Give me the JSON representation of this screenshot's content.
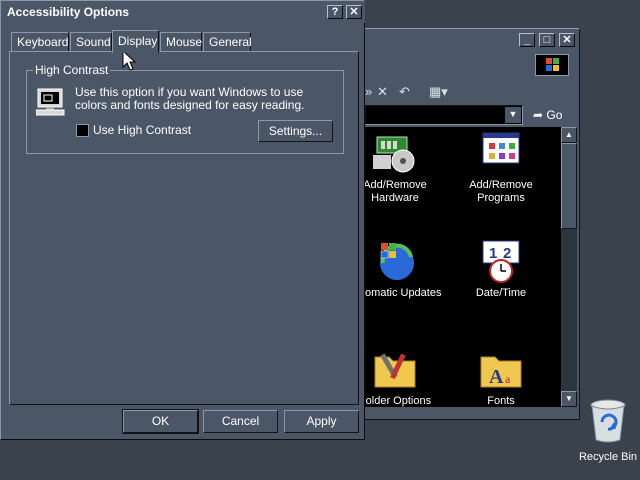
{
  "control_panel": {
    "go_label": "Go",
    "items": [
      {
        "label": "Add/Remove\nHardware",
        "icon": "hardware-icon"
      },
      {
        "label": "Add/Remove\nPrograms",
        "icon": "programs-icon"
      },
      {
        "label": "Automatic Updates",
        "icon": "windows-update-icon"
      },
      {
        "label": "Date/Time",
        "icon": "calendar-clock-icon"
      },
      {
        "label": "Folder Options",
        "icon": "folder-tools-icon"
      },
      {
        "label": "Fonts",
        "icon": "fonts-folder-icon"
      }
    ]
  },
  "dialog": {
    "title": "Accessibility Options",
    "help_label": "?",
    "close_label": "✕",
    "tabs": [
      "Keyboard",
      "Sound",
      "Display",
      "Mouse",
      "General"
    ],
    "active_tab": "Display",
    "high_contrast": {
      "group_label": "High Contrast",
      "description": "Use this option if you want Windows to use colors and fonts designed for easy reading.",
      "checkbox_label": "Use High Contrast",
      "checked": false,
      "settings_button": "Settings..."
    },
    "buttons": {
      "ok": "OK",
      "cancel": "Cancel",
      "apply": "Apply"
    }
  },
  "desktop": {
    "recycle_bin_label": "Recycle Bin"
  },
  "colors": {
    "desktop": "#39424d",
    "window_face": "#4b5767",
    "content_bg": "#000000",
    "text": "#ffffff"
  }
}
